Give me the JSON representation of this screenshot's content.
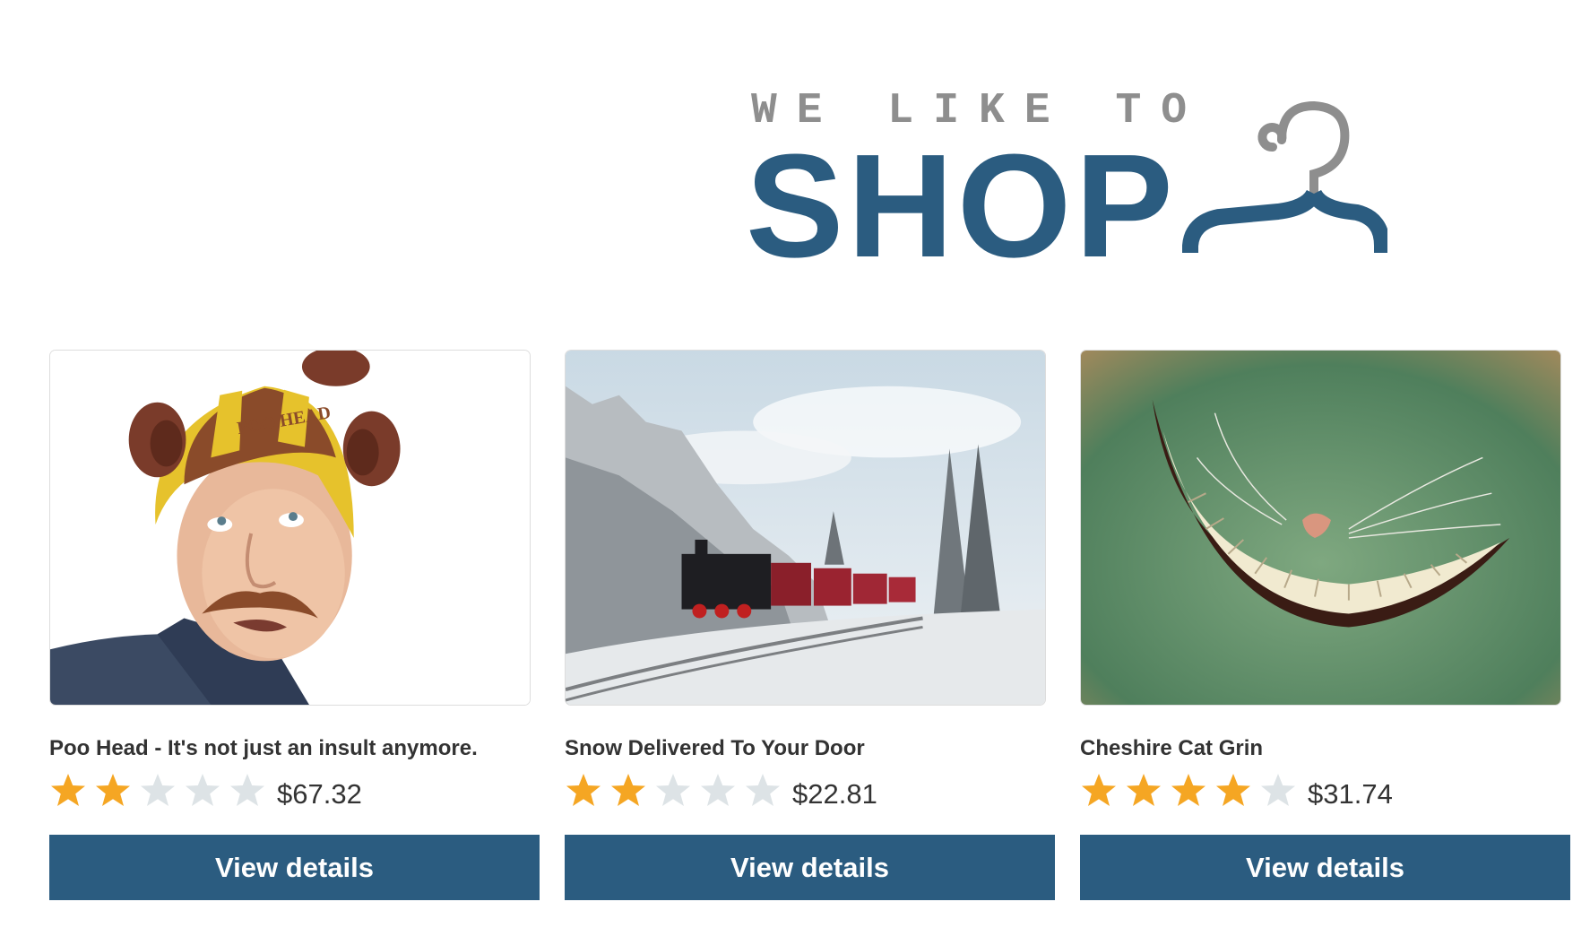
{
  "logo": {
    "tagline": "WE LIKE TO",
    "word": "SHOP",
    "icon": "hanger-icon",
    "color": "#2b5c80"
  },
  "products": [
    {
      "title": "Poo Head - It's not just an insult anymore.",
      "rating": 2,
      "max_rating": 5,
      "price": "$67.32",
      "button_label": "View details",
      "image": "man-wearing-poo-head-hat",
      "image_text": "POO HEAD"
    },
    {
      "title": "Snow Delivered To Your Door",
      "rating": 2,
      "max_rating": 5,
      "price": "$22.81",
      "button_label": "View details",
      "image": "steam-train-in-snowy-forest"
    },
    {
      "title": "Cheshire Cat Grin",
      "rating": 4,
      "max_rating": 5,
      "price": "$31.74",
      "button_label": "View details",
      "image": "cheshire-cat-grin-on-green"
    }
  ],
  "colors": {
    "star_filled": "#f5a623",
    "star_empty": "#dde3e6",
    "button_bg": "#2b5c80",
    "button_text": "#ffffff"
  }
}
